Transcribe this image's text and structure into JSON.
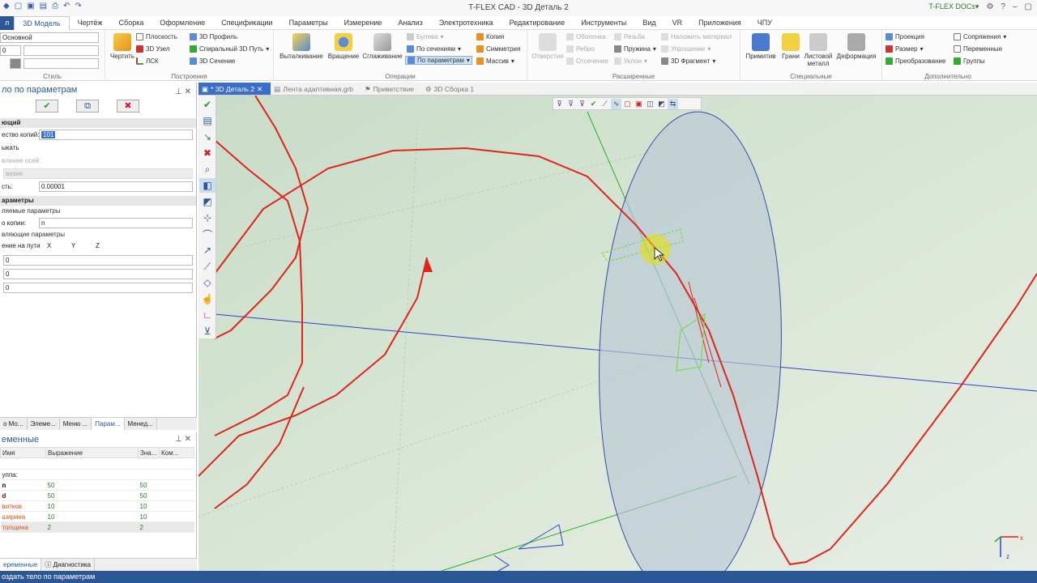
{
  "window": {
    "title": "T-FLEX CAD - 3D Деталь 2",
    "docs_label": "T-FLEX DOCs"
  },
  "menu": {
    "file": "л",
    "items": [
      "3D Модель",
      "Чертёж",
      "Сборка",
      "Оформление",
      "Спецификации",
      "Параметры",
      "Измерение",
      "Анализ",
      "Электротехника",
      "Редактирование",
      "Инструменты",
      "Вид",
      "VR",
      "Приложения",
      "ЧПУ"
    ]
  },
  "ribbon": {
    "style": {
      "combo1": "Основной",
      "combo2": "0",
      "label": "Стиль"
    },
    "constructions": {
      "label": "Построения",
      "draw": "Чертить",
      "plane": "Плоскость",
      "node3d": "3D Узел",
      "lsk": "ЛСК",
      "profile3d": "3D Профиль",
      "spiral": "Спиральный 3D Путь",
      "section3d": "3D Сечение"
    },
    "operations": {
      "label": "Операции",
      "extrude": "Выталкивание",
      "rotate": "Вращение",
      "smooth": "Сглаживание",
      "boolean": "Булева",
      "by_sections": "По сечениям",
      "by_params": "По параметрам",
      "copy": "Копия",
      "symmetry": "Симметрия",
      "array": "Массив"
    },
    "extended": {
      "label": "Расширенные",
      "hole": "Отверстие",
      "shell": "Оболочка",
      "rib": "Ребро",
      "cut": "Отсечение",
      "thread": "Резьба",
      "spring": "Пружина",
      "slope": "Уклон",
      "apply_material": "Наложить материал",
      "simplify": "Упрощение",
      "fragment3d": "3D Фрагмент"
    },
    "special": {
      "label": "Специальные",
      "primitives": "Примитив",
      "faces": "Грани",
      "sheet_metal": "Листовой металл",
      "deformation": "Деформация"
    },
    "additional": {
      "label": "Дополнительно",
      "projection": "Проекция",
      "size": "Размер",
      "transform": "Преобразование",
      "mates": "Сопряжения",
      "variables": "Переменные",
      "groups": "Группы"
    }
  },
  "panel": {
    "title": "ло по параметрам",
    "sections": {
      "general": "ющий",
      "params": "араметры"
    },
    "copies_label": "ество копий:",
    "copies_value": "101",
    "close_label": "ыкать",
    "axes_label": "вление осей:",
    "axes_value": "визне",
    "accuracy_label": "сть:",
    "accuracy_value": "0.00001",
    "varying_params": "ляемые параметры",
    "per_copy_label": "о копии:",
    "per_copy_value": "n",
    "controlling_params": "вляющие параметры",
    "path_label": "ение на пути",
    "axes": [
      "X",
      "Y",
      "Z"
    ],
    "path_values": [
      "0",
      "0",
      "0"
    ]
  },
  "panel_tabs": [
    "о Мо...",
    "Элеме...",
    "Меню ...",
    "Парам...",
    "Менед..."
  ],
  "variables": {
    "title": "еменные",
    "headers": [
      "Имя",
      "Выражение",
      "Зна...",
      "Ком..."
    ],
    "group_label": "уппа:",
    "rows": [
      {
        "name": "n",
        "expr": "50",
        "value": "50",
        "color": "#000000"
      },
      {
        "name": "d",
        "expr": "50",
        "value": "50",
        "color": "#8b0000"
      },
      {
        "name": "витков",
        "expr": "10",
        "value": "10",
        "color": "#e05010"
      },
      {
        "name": "ширина",
        "expr": "10",
        "value": "10",
        "color": "#e05010"
      },
      {
        "name": "толщина",
        "expr": "2",
        "value": "2",
        "color": "#e05010"
      }
    ]
  },
  "bottom_tabs": [
    "еременные",
    "Диагностика"
  ],
  "doc_tabs": [
    "* 3D Деталь 2",
    "Лента адаптивная.grb",
    "Приветствие",
    "3D Сборка 1"
  ],
  "status": "оздать тело по параметрам",
  "colors": {
    "accent": "#2b5797",
    "curve": "#e0241c",
    "green_axis": "#2ab02a",
    "blue_axis": "#3040c8",
    "ellipse_fill": "#b8c8d6"
  }
}
